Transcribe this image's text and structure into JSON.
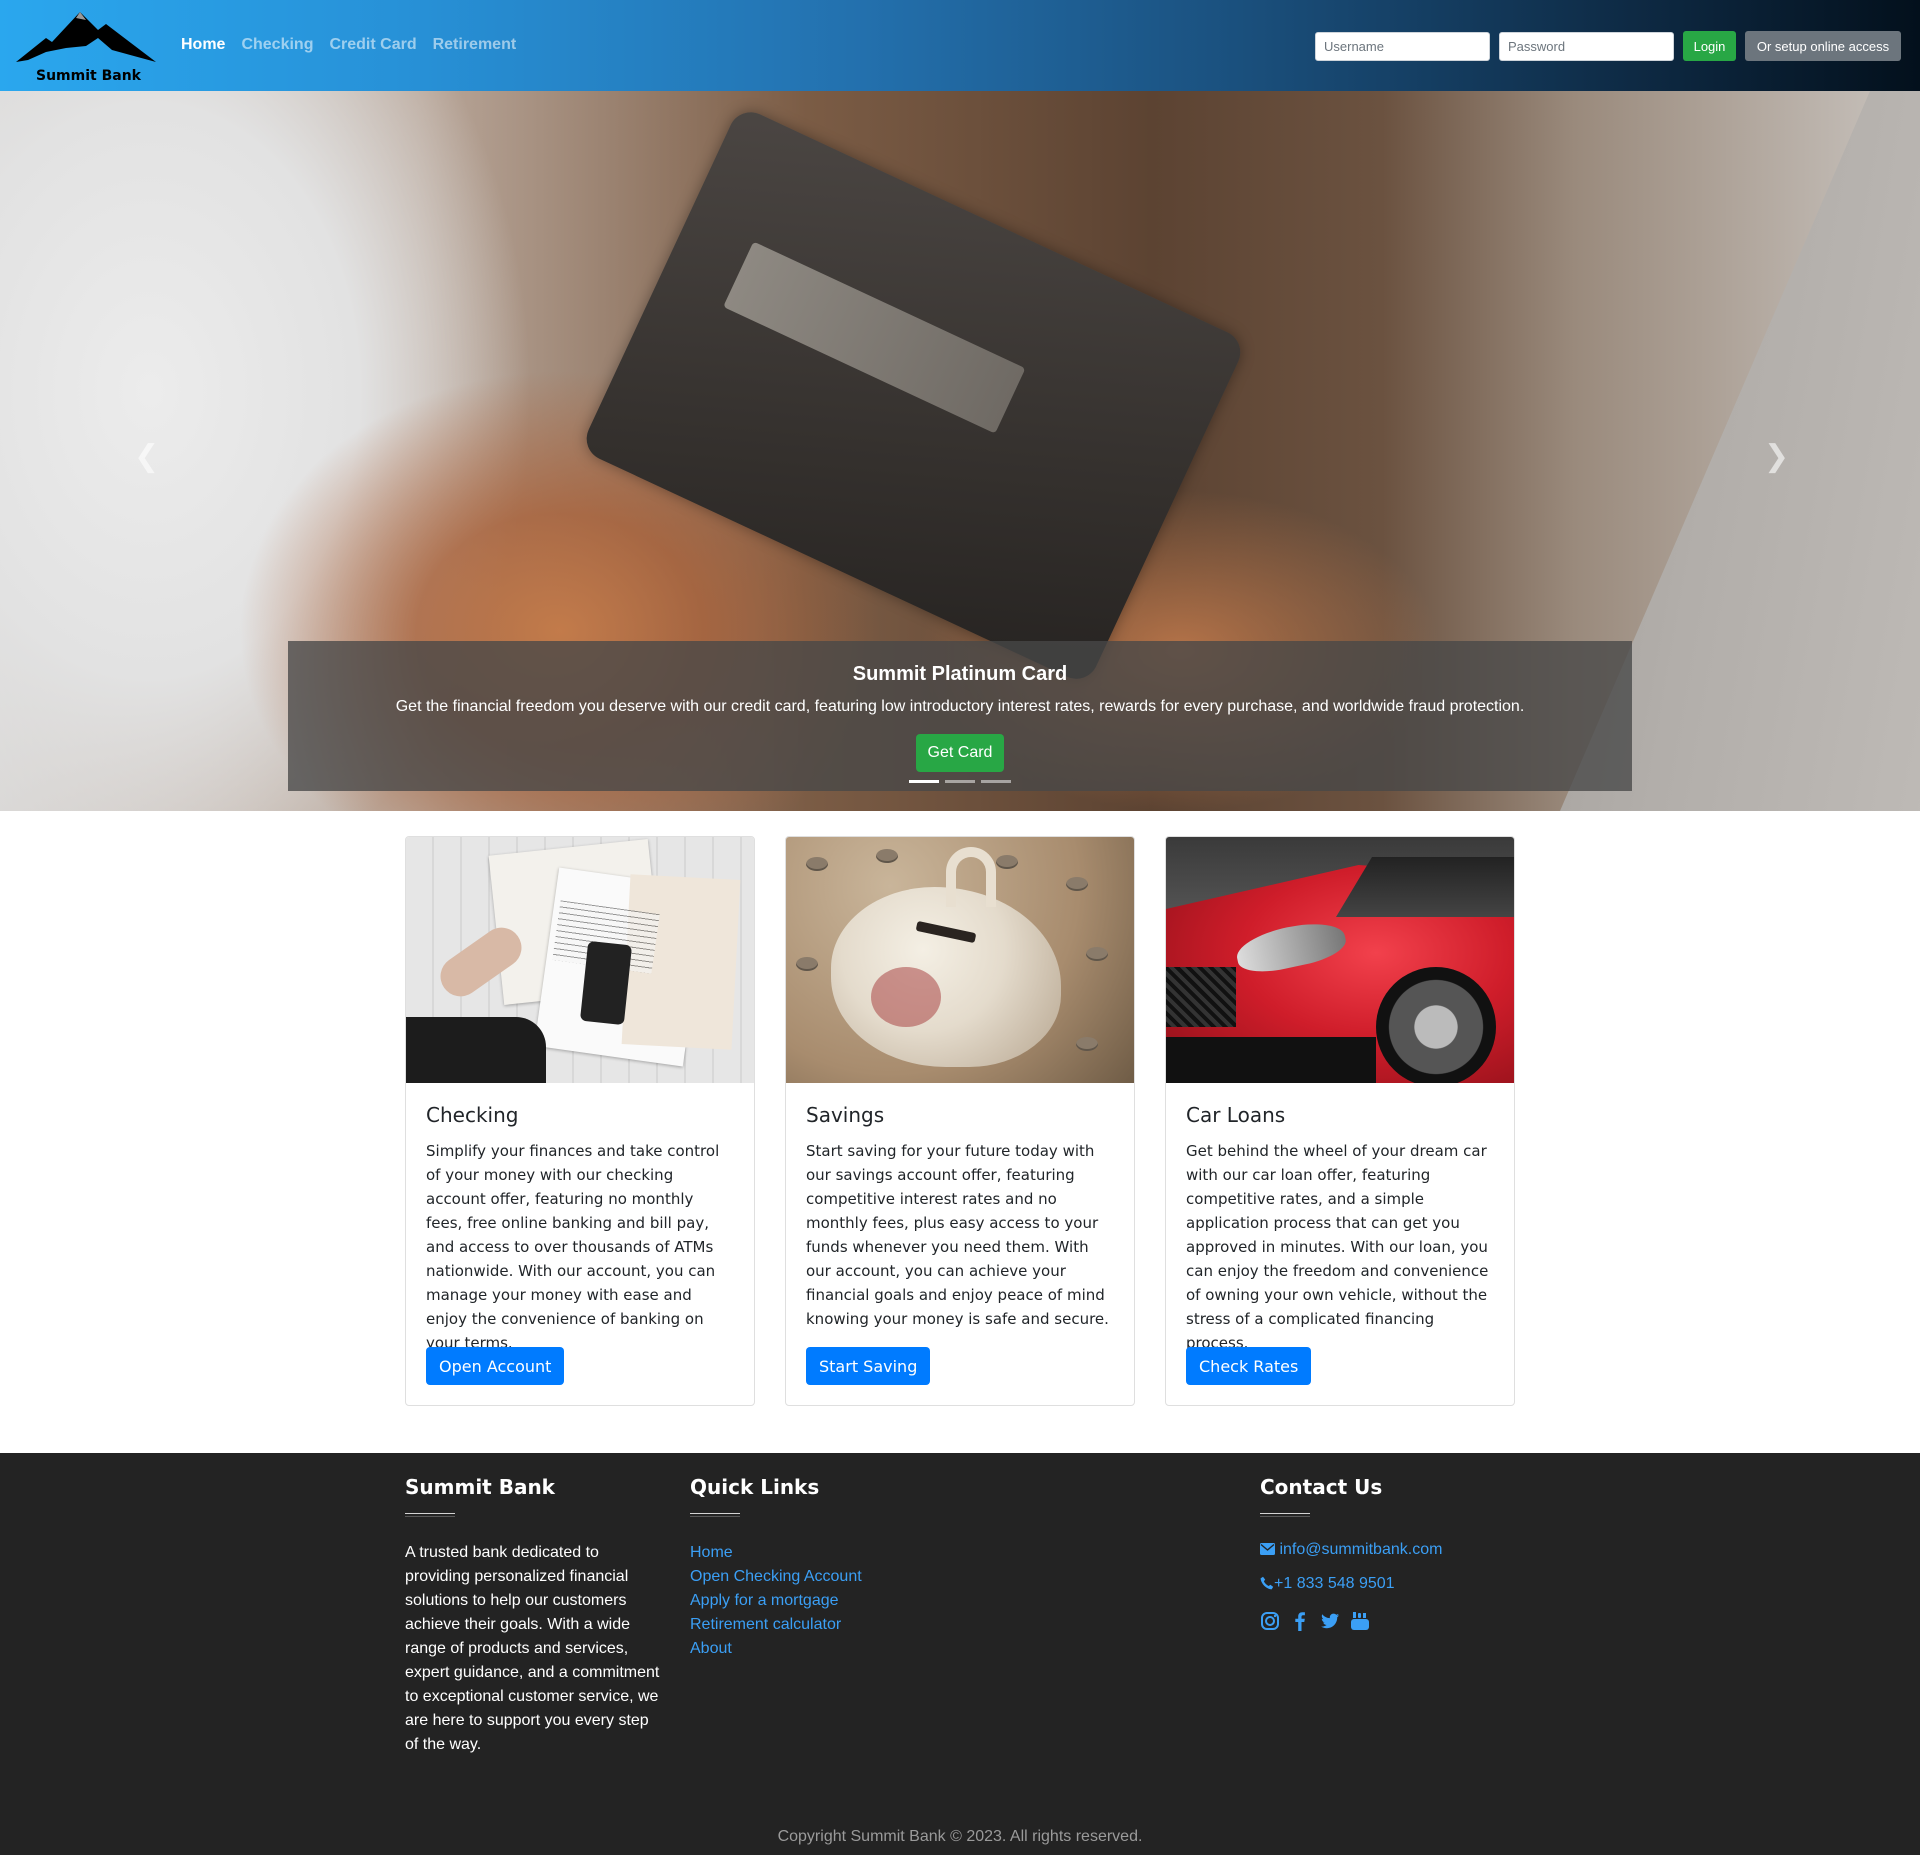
{
  "brand": {
    "name": "Summit Bank"
  },
  "nav": {
    "items": [
      {
        "label": "Home",
        "active": true
      },
      {
        "label": "Checking",
        "active": false
      },
      {
        "label": "Credit Card",
        "active": false
      },
      {
        "label": "Retirement",
        "active": false
      }
    ]
  },
  "login": {
    "username_placeholder": "Username",
    "password_placeholder": "Password",
    "login_label": "Login",
    "setup_label": "Or setup online access"
  },
  "hero": {
    "title": "Summit Platinum Card",
    "text": "Get the financial freedom you deserve with our credit card, featuring low introductory interest rates, rewards for every purchase, and worldwide fraud protection.",
    "button_label": "Get Card",
    "slide_count": 3,
    "active_slide": 1
  },
  "cards": [
    {
      "title": "Checking",
      "text": "Simplify your finances and take control of your money with our checking account offer, featuring no monthly fees, free online banking and bill pay, and access to over thousands of ATMs nationwide. With our account, you can manage your money with ease and enjoy the convenience of banking on your terms.",
      "button_label": "Open Account"
    },
    {
      "title": "Savings",
      "text": "Start saving for your future today with our savings account offer, featuring competitive interest rates and no monthly fees, plus easy access to your funds whenever you need them. With our account, you can achieve your financial goals and enjoy peace of mind knowing your money is safe and secure.",
      "button_label": "Start Saving"
    },
    {
      "title": "Car Loans",
      "text": "Get behind the wheel of your dream car with our car loan offer, featuring competitive rates, and a simple application process that can get you approved in minutes. With our loan, you can enjoy the freedom and convenience of owning your own vehicle, without the stress of a complicated financing process.",
      "button_label": "Check Rates"
    }
  ],
  "footer": {
    "about": {
      "title": "Summit Bank",
      "text": "A trusted bank dedicated to providing personalized financial solutions to help our customers achieve their goals. With a wide range of products and services, expert guidance, and a commitment to exceptional customer service, we are here to support you every step of the way."
    },
    "quick_links": {
      "title": "Quick Links",
      "items": [
        "Home",
        "Open Checking Account",
        "Apply for a mortgage",
        "Retirement calculator",
        "About"
      ]
    },
    "contact": {
      "title": "Contact Us",
      "email": "info@summitbank.com",
      "phone": "+1 833 548 9501",
      "socials": [
        "instagram-icon",
        "facebook-icon",
        "twitter-icon",
        "youtube-icon"
      ]
    },
    "copyright": "Copyright Summit Bank © 2023. All rights reserved."
  },
  "colors": {
    "primary": "#007bff",
    "success": "#28a745",
    "secondary": "#6c757d",
    "footer_bg": "#232323",
    "link": "#3b9ff5"
  }
}
